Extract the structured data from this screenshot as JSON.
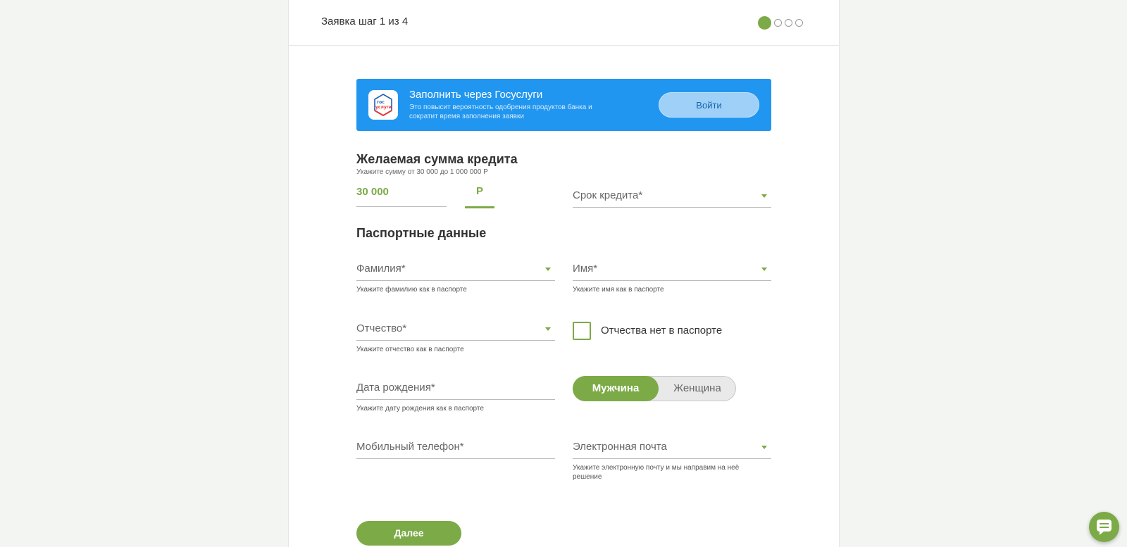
{
  "header": {
    "step_title": "Заявка шаг 1 из 4",
    "steps_total": 4,
    "current_step": 1
  },
  "gosuslugi": {
    "logo_text_top": "гос",
    "logo_text_bottom": "услуги",
    "title": "Заполнить через Госуслуги",
    "description": "Это повысит вероятность одобрения продуктов банка и сократит время заполнения заявки",
    "login_label": "Войти"
  },
  "credit": {
    "title": "Желаемая сумма кредита",
    "hint": "Укажите сумму от 30 000 до 1 000 000 Р",
    "amount": "30 000",
    "currency": "Р",
    "term_label": "Срок кредита*"
  },
  "passport": {
    "title": "Паспортные данные",
    "surname_label": "Фамилия*",
    "surname_hint": "Укажите фамилию как в паспорте",
    "name_label": "Имя*",
    "name_hint": "Укажите имя как в паспорте",
    "patronymic_label": "Отчество*",
    "patronymic_hint": "Укажите отчество как в паспорте",
    "no_patronymic_label": "Отчества нет в паспорте",
    "birthdate_label": "Дата рождения*",
    "birthdate_hint": "Укажите дату рождения как в паспорте",
    "gender_male": "Мужчина",
    "gender_female": "Женщина",
    "phone_label": "Мобильный телефон*",
    "email_label": "Электронная почта",
    "email_hint": "Укажите электронную почту и мы направим на неё решение"
  },
  "actions": {
    "next_label": "Далее"
  },
  "icons": {
    "chat": "chat-icon",
    "gosuslugi_logo": "gosuslugi-logo"
  },
  "colors": {
    "accent": "#7caa47",
    "gosuslugi_blue": "#2196f0"
  }
}
